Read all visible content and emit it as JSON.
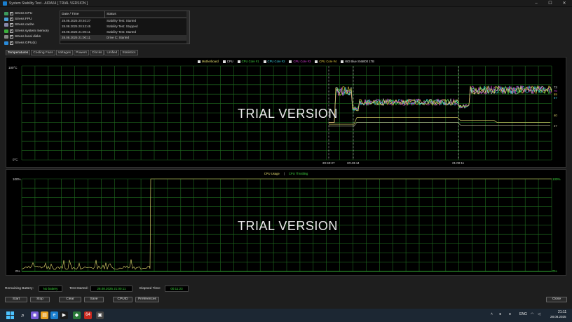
{
  "window": {
    "title": "System Stability Test - AIDA64  [ TRIAL VERSION ]"
  },
  "stress_options": [
    {
      "label": "Stress CPU",
      "color": "#3c9a5c"
    },
    {
      "label": "Stress FPU",
      "color": "#4aa0d8"
    },
    {
      "label": "Stress cache",
      "color": "#8888aa"
    },
    {
      "label": "Stress system memory",
      "color": "#3cae3c"
    },
    {
      "label": "Stress local disks",
      "color": "#888888"
    },
    {
      "label": "Stress GPU(s)",
      "color": "#2a8ad8"
    }
  ],
  "log": {
    "headers": [
      "Date / Time",
      "Status"
    ],
    "rows": [
      [
        "28.08.2025 20:40:27",
        "Stability Test: Started"
      ],
      [
        "28.08.2025 20:43:45",
        "Stability Test: Stopped"
      ],
      [
        "28.08.2025 21:00:11",
        "Stability Test: Started"
      ],
      [
        "28.08.2025 21:00:11",
        "Drive C: Started"
      ]
    ]
  },
  "tabs": [
    "Temperatures",
    "Cooling Fans",
    "Voltages",
    "Powers",
    "Clocks",
    "Unified",
    "Statistics"
  ],
  "temp_chart": {
    "legend": [
      {
        "label": "Motherboard",
        "color": "#e8e070"
      },
      {
        "label": "CPU",
        "color": "#e8e8e8"
      },
      {
        "label": "CPU Core #1",
        "color": "#40d840"
      },
      {
        "label": "CPU Core #2",
        "color": "#40d8e8"
      },
      {
        "label": "CPU Core #3",
        "color": "#d840d8"
      },
      {
        "label": "CPU Core #4",
        "color": "#e8d040"
      },
      {
        "label": "WD Blue SN5000 1TB",
        "color": "#e8e8e8"
      }
    ],
    "y_max_label": "100°C",
    "y_min_label": "0°C",
    "x_labels": [
      "20:40:27",
      "20:43:44",
      "21:00:11"
    ],
    "right_values": [
      "73",
      "70",
      "69",
      "67",
      "40",
      "37"
    ],
    "watermark": "TRIAL VERSION"
  },
  "usage_chart": {
    "legend": [
      {
        "label": "CPU Usage",
        "color": "#e8e070"
      },
      {
        "label": "CPU Throttling",
        "color": "#40d840"
      }
    ],
    "separator": "|",
    "y_max_label": "100%",
    "y_min_label": "0%",
    "right_max_label": "100%",
    "right_min_label": "0%",
    "watermark": "TRIAL VERSION"
  },
  "status": {
    "battery_label": "Remaining Battery:",
    "battery_value": "No battery",
    "started_label": "Test Started:",
    "started_value": "28.08.2025 21:00:11",
    "elapsed_label": "Elapsed Time:",
    "elapsed_value": "00:11:23"
  },
  "buttons": {
    "start": "Start",
    "stop": "Stop",
    "clear": "Clear",
    "save": "Save",
    "cpuid": "CPUID",
    "preferences": "Preferences",
    "close": "Close"
  },
  "taskbar": {
    "lang": "ENG",
    "time": "21:11",
    "date": "28.08.2025"
  }
}
